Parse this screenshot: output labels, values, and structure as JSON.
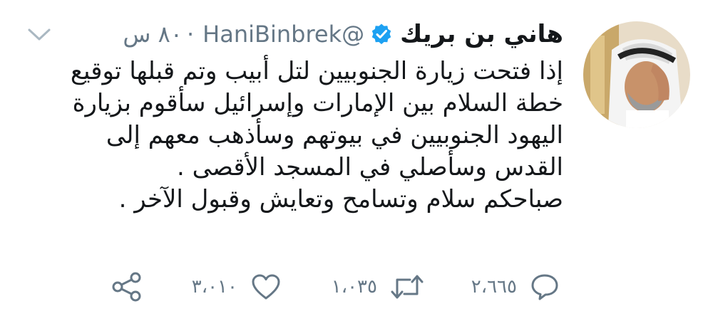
{
  "tweet": {
    "author_name": "هاني بن بريك",
    "handle": "@HaniBinbrek",
    "separator": "·",
    "time": "٨٠ س",
    "body_lines": [
      "إذا فتحت زيارة الجنوبيين لتل أبيب وتم قبلها توقيع",
      "خطة السلام بين الإمارات وإسرائيل سأقوم بزيارة",
      "اليهود الجنوبيين في بيوتهم وسأذهب معهم إلى",
      "القدس وسأصلي في المسجد الأقصى .",
      "صباحكم سلام وتسامح وتعايش وقبول الآخر ."
    ]
  },
  "actions": {
    "replies": "٢،٦٦٥",
    "retweets": "١،٠٣٥",
    "likes": "٣،٠١٠"
  },
  "icons": {
    "verified": "verified-badge-icon",
    "caret": "chevron-down-icon",
    "reply": "reply-icon",
    "retweet": "retweet-icon",
    "like": "heart-icon",
    "share": "share-icon"
  },
  "colors": {
    "verified": "#1da1f2",
    "muted": "#657786",
    "text": "#14171a"
  }
}
